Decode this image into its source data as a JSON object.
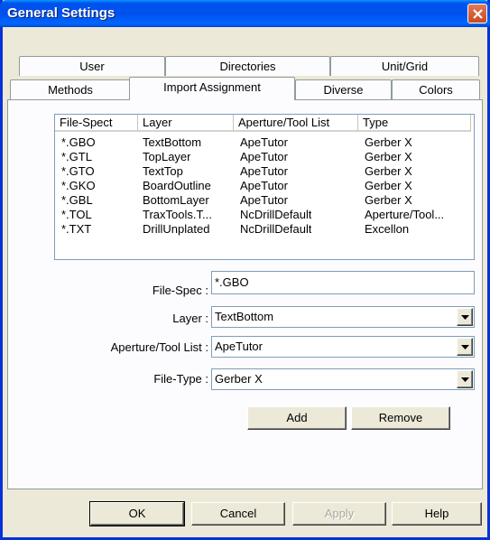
{
  "window": {
    "title": "General Settings"
  },
  "tabs": {
    "row1": [
      "User",
      "Directories",
      "Unit/Grid"
    ],
    "row2": [
      "Methods",
      "Import Assignment",
      "Diverse",
      "Colors"
    ],
    "active": "Import Assignment"
  },
  "list": {
    "columns": [
      "File-Spect",
      "Layer",
      "Aperture/Tool List",
      "Type"
    ],
    "rows": [
      [
        "*.GBO",
        "TextBottom",
        "ApeTutor",
        "Gerber X"
      ],
      [
        "*.GTL",
        "TopLayer",
        "ApeTutor",
        "Gerber X"
      ],
      [
        "*.GTO",
        "TextTop",
        "ApeTutor",
        "Gerber X"
      ],
      [
        "*.GKO",
        "BoardOutline",
        "ApeTutor",
        "Gerber X"
      ],
      [
        "*.GBL",
        "BottomLayer",
        "ApeTutor",
        "Gerber X"
      ],
      [
        "*.TOL",
        "TraxTools.T...",
        "NcDrillDefault",
        "Aperture/Tool..."
      ],
      [
        "*.TXT",
        "DrillUnplated",
        "NcDrillDefault",
        "Excellon"
      ]
    ]
  },
  "form": {
    "filespec_label": "File-Spec :",
    "filespec_value": "*.GBO",
    "layer_label": "Layer :",
    "layer_value": "TextBottom",
    "aperture_label": "Aperture/Tool List :",
    "aperture_value": "ApeTutor",
    "filetype_label": "File-Type :",
    "filetype_value": "Gerber X",
    "add_label": "Add",
    "remove_label": "Remove"
  },
  "footer": {
    "ok_label": "OK",
    "cancel_label": "Cancel",
    "apply_label": "Apply",
    "help_label": "Help"
  }
}
